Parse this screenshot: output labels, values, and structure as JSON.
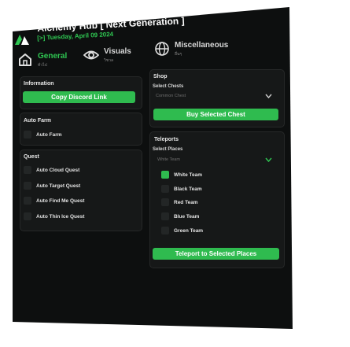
{
  "header": {
    "title": "Alchemy Hub [ Next Generation ]",
    "date": "[>] Tuesday, April 09 2024",
    "accent": "#2fc752"
  },
  "tabs": [
    {
      "label": "General",
      "sub": "ทั่วไป",
      "icon": "home-icon",
      "active": true
    },
    {
      "label": "Visuals",
      "sub": "วิชวล",
      "icon": "eye-icon",
      "active": false
    },
    {
      "label": "Miscellaneous",
      "sub": "อื่นๆ",
      "icon": "globe-icon",
      "active": false
    }
  ],
  "left": {
    "information": {
      "title": "Information",
      "button": "Copy Discord Link"
    },
    "auto_farm": {
      "title": "Auto Farm",
      "toggles": [
        {
          "label": "Auto Farm",
          "checked": false
        }
      ]
    },
    "quest": {
      "title": "Quest",
      "toggles": [
        {
          "label": "Auto Cloud Quest",
          "checked": false
        },
        {
          "label": "Auto Target Quest",
          "checked": false
        },
        {
          "label": "Auto Find Me Quest",
          "checked": false
        },
        {
          "label": "Auto Thin Ice Quest",
          "checked": false
        }
      ]
    }
  },
  "right": {
    "shop": {
      "title": "Shop",
      "select_label": "Select Chests",
      "select_value": "Common Chest",
      "button": "Buy Selected Chest"
    },
    "teleports": {
      "title": "Teleports",
      "select_label": "Select Places",
      "select_value": "White Team",
      "options": [
        {
          "label": "White Team",
          "checked": true
        },
        {
          "label": "Black Team",
          "checked": false
        },
        {
          "label": "Red Team",
          "checked": false
        },
        {
          "label": "Blue Team",
          "checked": false
        },
        {
          "label": "Green Team",
          "checked": false
        }
      ],
      "button": "Teleport to Selected Places"
    }
  }
}
